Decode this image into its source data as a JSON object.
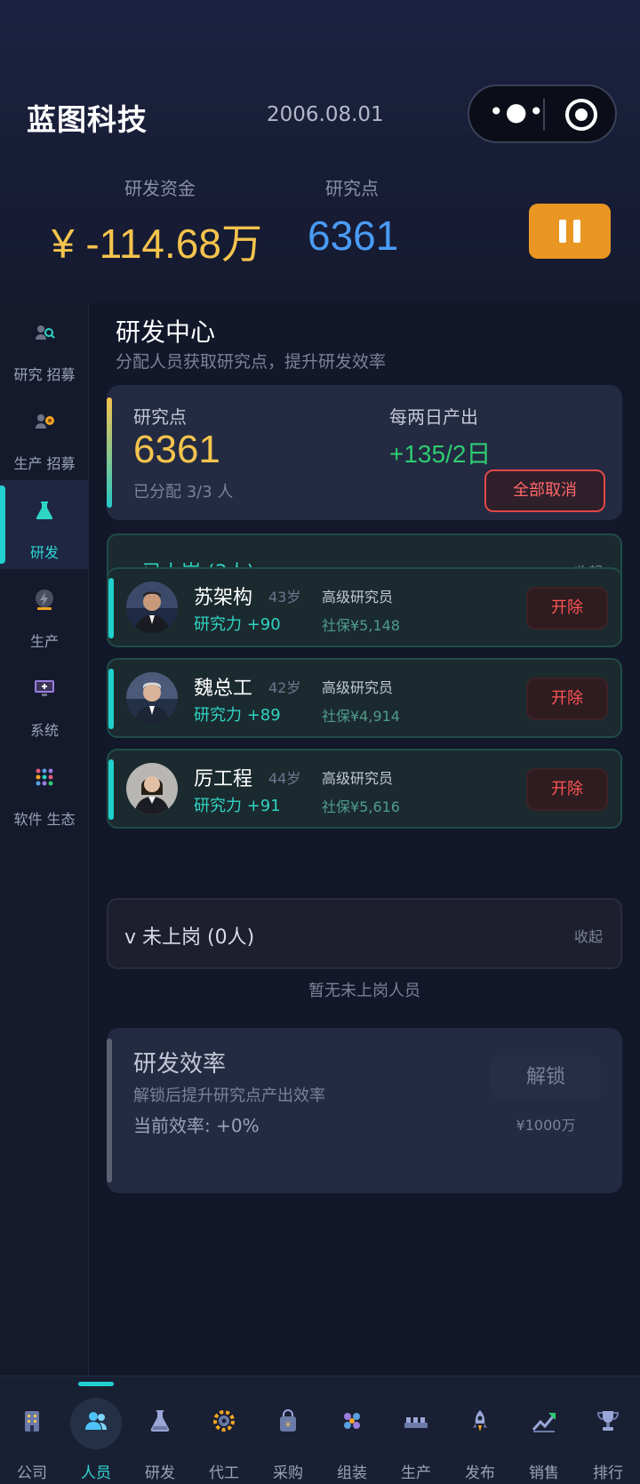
{
  "header": {
    "company": "蓝图科技",
    "date": "2006.08.01",
    "menu_icon": "more-dots-icon",
    "close_icon": "target-icon"
  },
  "stats": {
    "funds_label": "研发资金",
    "funds_value": "¥ -114.68万",
    "points_label": "研究点",
    "points_value": "6361",
    "pause_icon": "pause-icon"
  },
  "sidebar": {
    "items": [
      {
        "label": "研究 招募",
        "icon": "research-recruit-icon"
      },
      {
        "label": "生产 招募",
        "icon": "production-recruit-icon"
      },
      {
        "label": "研发",
        "icon": "flask-icon",
        "active": true
      },
      {
        "label": "生产",
        "icon": "lightning-icon"
      },
      {
        "label": "系统",
        "icon": "monitor-icon"
      },
      {
        "label": "软件 生态",
        "icon": "apps-grid-icon"
      }
    ]
  },
  "rd": {
    "title": "研发中心",
    "subtitle": "分配人员获取研究点，提升研发效率",
    "points_label": "研究点",
    "points_value": "6361",
    "assigned": "已分配 3/3 人",
    "output_label": "每两日产出",
    "output_value": "+135/2日",
    "cancel_all": "全部取消"
  },
  "on_duty": {
    "title": "v 已上岗 (3人)",
    "fold": "收起",
    "people": [
      {
        "name": "苏架构",
        "age": "43岁",
        "power": "研究力 +90",
        "title": "高级研究员",
        "insurance": "社保¥5,148",
        "action": "开除"
      },
      {
        "name": "魏总工",
        "age": "42岁",
        "power": "研究力 +89",
        "title": "高级研究员",
        "insurance": "社保¥4,914",
        "action": "开除"
      },
      {
        "name": "厉工程",
        "age": "44岁",
        "power": "研究力 +91",
        "title": "高级研究员",
        "insurance": "社保¥5,616",
        "action": "开除"
      }
    ]
  },
  "off_duty": {
    "title": "v 未上岗 (0人)",
    "fold": "收起",
    "empty": "暂无未上岗人员"
  },
  "efficiency": {
    "title": "研发效率",
    "desc": "解锁后提升研究点产出效率",
    "current": "当前效率: +0%",
    "unlock": "解锁",
    "price": "¥1000万"
  },
  "tabs": [
    {
      "label": "公司",
      "icon": "building-icon"
    },
    {
      "label": "人员",
      "icon": "people-icon",
      "active": true
    },
    {
      "label": "研发",
      "icon": "flask-icon"
    },
    {
      "label": "代工",
      "icon": "gear-icon"
    },
    {
      "label": "采购",
      "icon": "shopping-bag-icon"
    },
    {
      "label": "组装",
      "icon": "components-icon"
    },
    {
      "label": "生产",
      "icon": "factory-icon"
    },
    {
      "label": "发布",
      "icon": "rocket-icon"
    },
    {
      "label": "销售",
      "icon": "trend-chart-icon"
    },
    {
      "label": "排行",
      "icon": "trophy-icon"
    }
  ]
}
